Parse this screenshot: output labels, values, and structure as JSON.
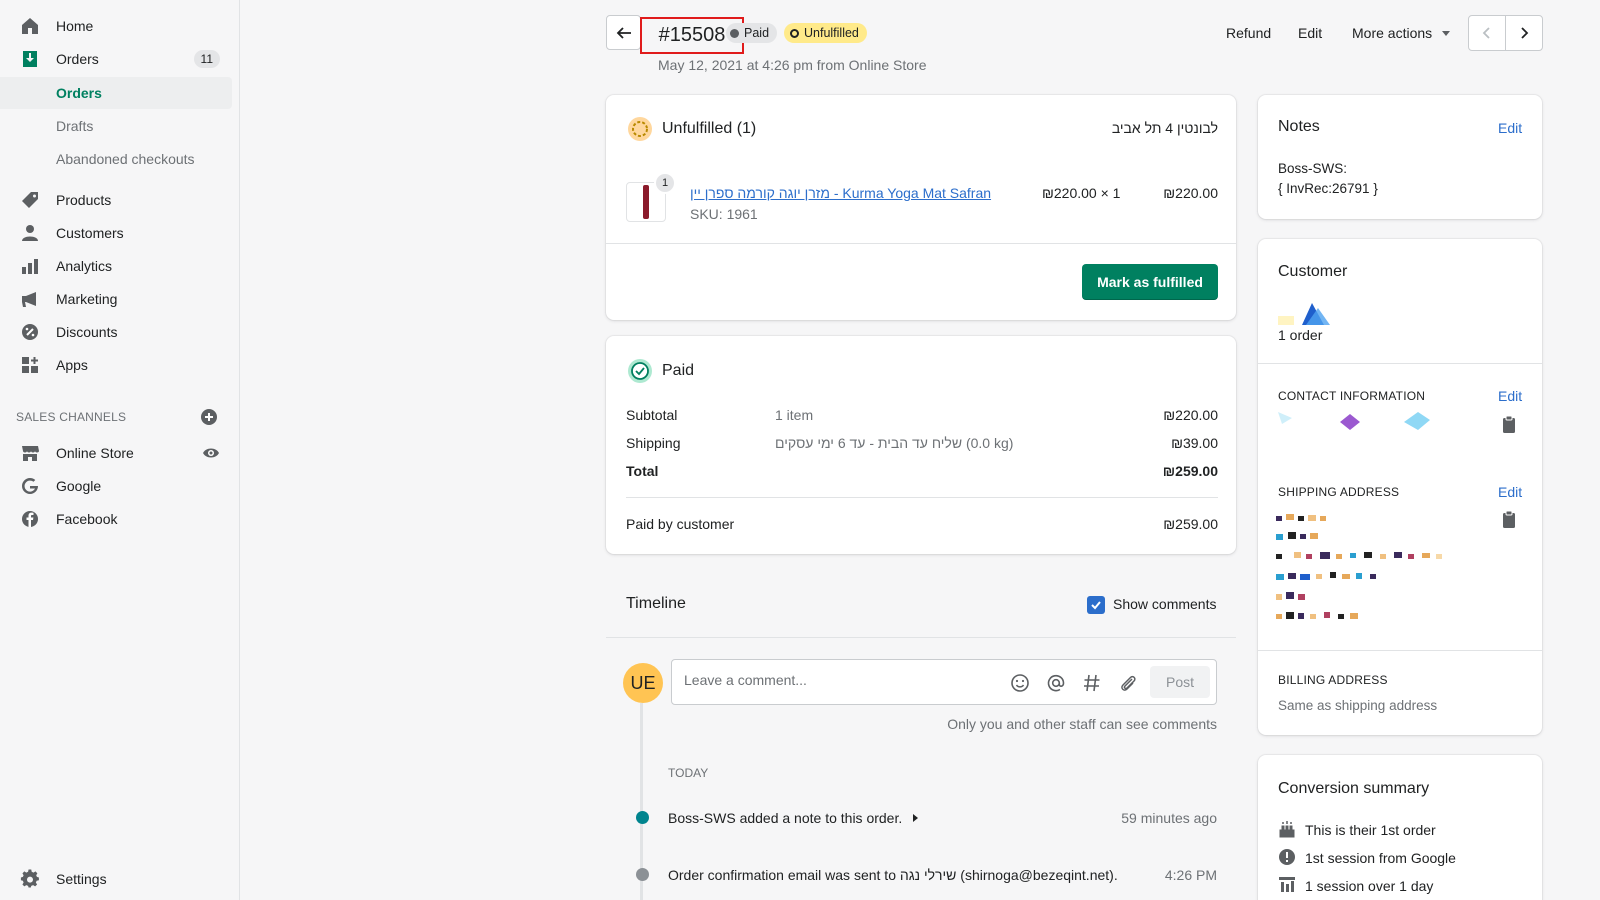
{
  "sidebar": {
    "home": "Home",
    "orders": "Orders",
    "orders_count": "11",
    "orders_sub": "Orders",
    "drafts": "Drafts",
    "abandoned": "Abandoned checkouts",
    "products": "Products",
    "customers": "Customers",
    "analytics": "Analytics",
    "marketing": "Marketing",
    "discounts": "Discounts",
    "apps": "Apps",
    "sales_channels": "SALES CHANNELS",
    "online_store": "Online Store",
    "google": "Google",
    "facebook": "Facebook",
    "settings": "Settings"
  },
  "header": {
    "order_number": "#15508",
    "paid_badge": "Paid",
    "unfulfilled_badge": "Unfulfilled",
    "date": "May 12, 2021 at 4:26 pm from Online Store",
    "refund": "Refund",
    "edit": "Edit",
    "more_actions": "More actions"
  },
  "unfulfilled_card": {
    "title": "Unfulfilled (1)",
    "location": "לבונטין 4 תל אביב",
    "item": {
      "qty_badge": "1",
      "name": "מזרן יוגה קורמה ספרן יין - Kurma Yoga Mat Safran",
      "sku": "SKU: 1961",
      "unit": "₪220.00 × 1",
      "total": "₪220.00"
    },
    "mark_fulfilled": "Mark as fulfilled"
  },
  "paid_card": {
    "title": "Paid",
    "subtotal_label": "Subtotal",
    "subtotal_desc": "1 item",
    "subtotal_value": "₪220.00",
    "shipping_label": "Shipping",
    "shipping_desc": "שליח עד הבית - עד 6 ימי עסקים (0.0 kg)",
    "shipping_value": "₪39.00",
    "total_label": "Total",
    "total_value": "₪259.00",
    "paid_by_label": "Paid by customer",
    "paid_by_value": "₪259.00"
  },
  "timeline": {
    "title": "Timeline",
    "show_comments": "Show comments",
    "avatar_initials": "UE",
    "comment_placeholder": "Leave a comment...",
    "post": "Post",
    "staff_note": "Only you and other staff can see comments",
    "today": "TODAY",
    "events": [
      {
        "text": "Boss-SWS added a note to this order.",
        "time": "59 minutes ago"
      },
      {
        "text": "Order confirmation email was sent to שירלי נגה (shirnoga@bezeqint.net).",
        "time": "4:26 PM"
      }
    ]
  },
  "notes_card": {
    "title": "Notes",
    "edit": "Edit",
    "line1": "Boss-SWS:",
    "line2": "{ InvRec:26791 }"
  },
  "customer_card": {
    "title": "Customer",
    "orders": "1 order",
    "contact_label": "CONTACT INFORMATION",
    "contact_edit": "Edit",
    "shipping_label": "SHIPPING ADDRESS",
    "shipping_edit": "Edit",
    "billing_label": "BILLING ADDRESS",
    "billing_value": "Same as shipping address"
  },
  "conversion_card": {
    "title": "Conversion summary",
    "line1": "This is their 1st order",
    "line2": "1st session from Google",
    "line3": "1 session over 1 day"
  }
}
